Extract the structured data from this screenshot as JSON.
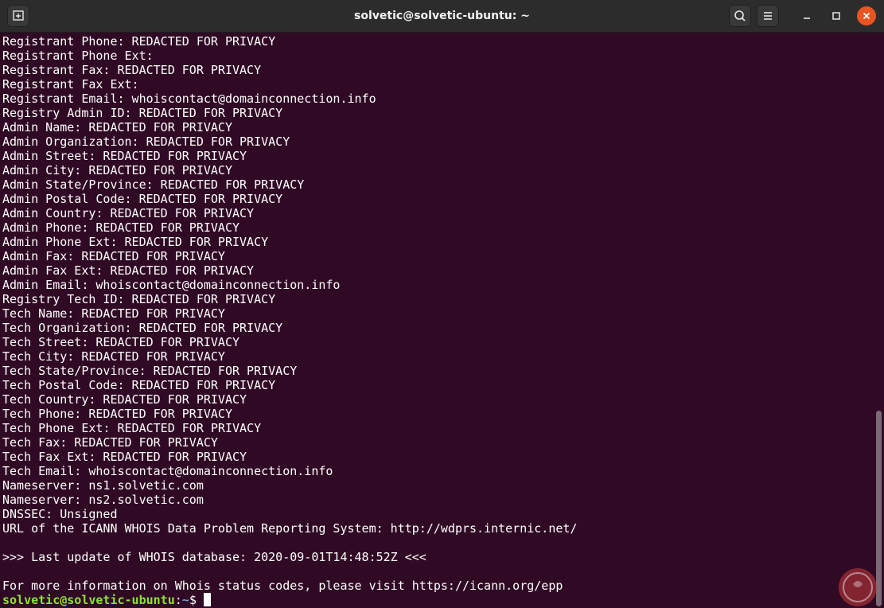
{
  "window": {
    "title": "solvetic@solvetic-ubuntu: ~"
  },
  "titlebar": {
    "new_tab_icon": "new-tab-icon",
    "search_icon": "search-icon",
    "menu_icon": "hamburger-menu-icon",
    "minimize_icon": "minimize-icon",
    "maximize_icon": "maximize-icon",
    "close_icon": "close-icon"
  },
  "colors": {
    "background": "#300a24",
    "text": "#ffffff",
    "prompt_user": "#8ae234",
    "prompt_path": "#729fcf",
    "close_button": "#e95420"
  },
  "terminal": {
    "lines": [
      "Registrant Phone: REDACTED FOR PRIVACY",
      "Registrant Phone Ext:",
      "Registrant Fax: REDACTED FOR PRIVACY",
      "Registrant Fax Ext:",
      "Registrant Email: whoiscontact@domainconnection.info",
      "Registry Admin ID: REDACTED FOR PRIVACY",
      "Admin Name: REDACTED FOR PRIVACY",
      "Admin Organization: REDACTED FOR PRIVACY",
      "Admin Street: REDACTED FOR PRIVACY",
      "Admin City: REDACTED FOR PRIVACY",
      "Admin State/Province: REDACTED FOR PRIVACY",
      "Admin Postal Code: REDACTED FOR PRIVACY",
      "Admin Country: REDACTED FOR PRIVACY",
      "Admin Phone: REDACTED FOR PRIVACY",
      "Admin Phone Ext: REDACTED FOR PRIVACY",
      "Admin Fax: REDACTED FOR PRIVACY",
      "Admin Fax Ext: REDACTED FOR PRIVACY",
      "Admin Email: whoiscontact@domainconnection.info",
      "Registry Tech ID: REDACTED FOR PRIVACY",
      "Tech Name: REDACTED FOR PRIVACY",
      "Tech Organization: REDACTED FOR PRIVACY",
      "Tech Street: REDACTED FOR PRIVACY",
      "Tech City: REDACTED FOR PRIVACY",
      "Tech State/Province: REDACTED FOR PRIVACY",
      "Tech Postal Code: REDACTED FOR PRIVACY",
      "Tech Country: REDACTED FOR PRIVACY",
      "Tech Phone: REDACTED FOR PRIVACY",
      "Tech Phone Ext: REDACTED FOR PRIVACY",
      "Tech Fax: REDACTED FOR PRIVACY",
      "Tech Fax Ext: REDACTED FOR PRIVACY",
      "Tech Email: whoiscontact@domainconnection.info",
      "Nameserver: ns1.solvetic.com",
      "Nameserver: ns2.solvetic.com",
      "DNSSEC: Unsigned",
      "URL of the ICANN WHOIS Data Problem Reporting System: http://wdprs.internic.net/",
      "",
      ">>> Last update of WHOIS database: 2020-09-01T14:48:52Z <<<",
      "",
      "For more information on Whois status codes, please visit https://icann.org/epp"
    ],
    "prompt": {
      "user_host": "solvetic@solvetic-ubuntu",
      "separator": ":",
      "path": "~",
      "symbol": "$ "
    }
  }
}
